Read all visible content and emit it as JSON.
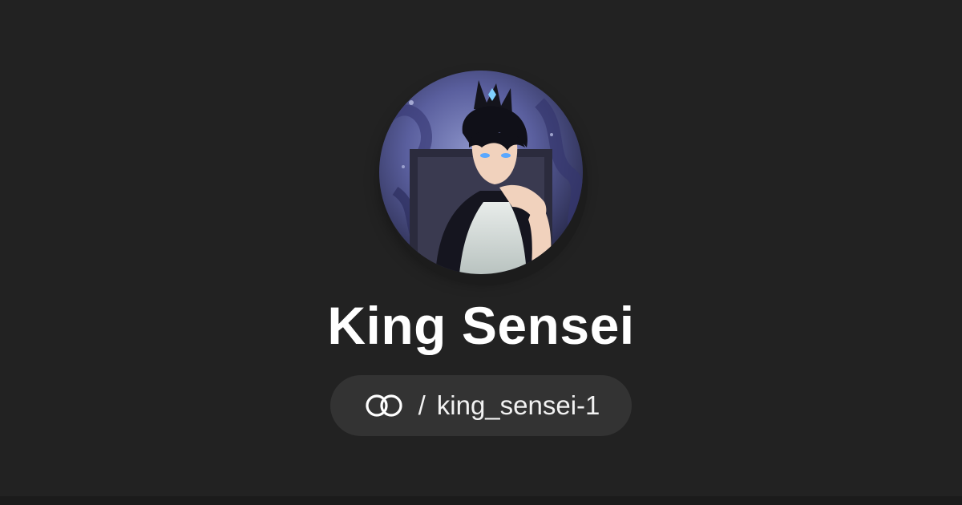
{
  "profile": {
    "display_name": "King Sensei",
    "separator": "/",
    "username": "king_sensei-1",
    "avatar_icon": "anime-character-avatar",
    "brand_icon": "linktree-rings-logo"
  },
  "colors": {
    "background": "#222222",
    "pill_background": "#333333",
    "text": "#ffffff"
  }
}
